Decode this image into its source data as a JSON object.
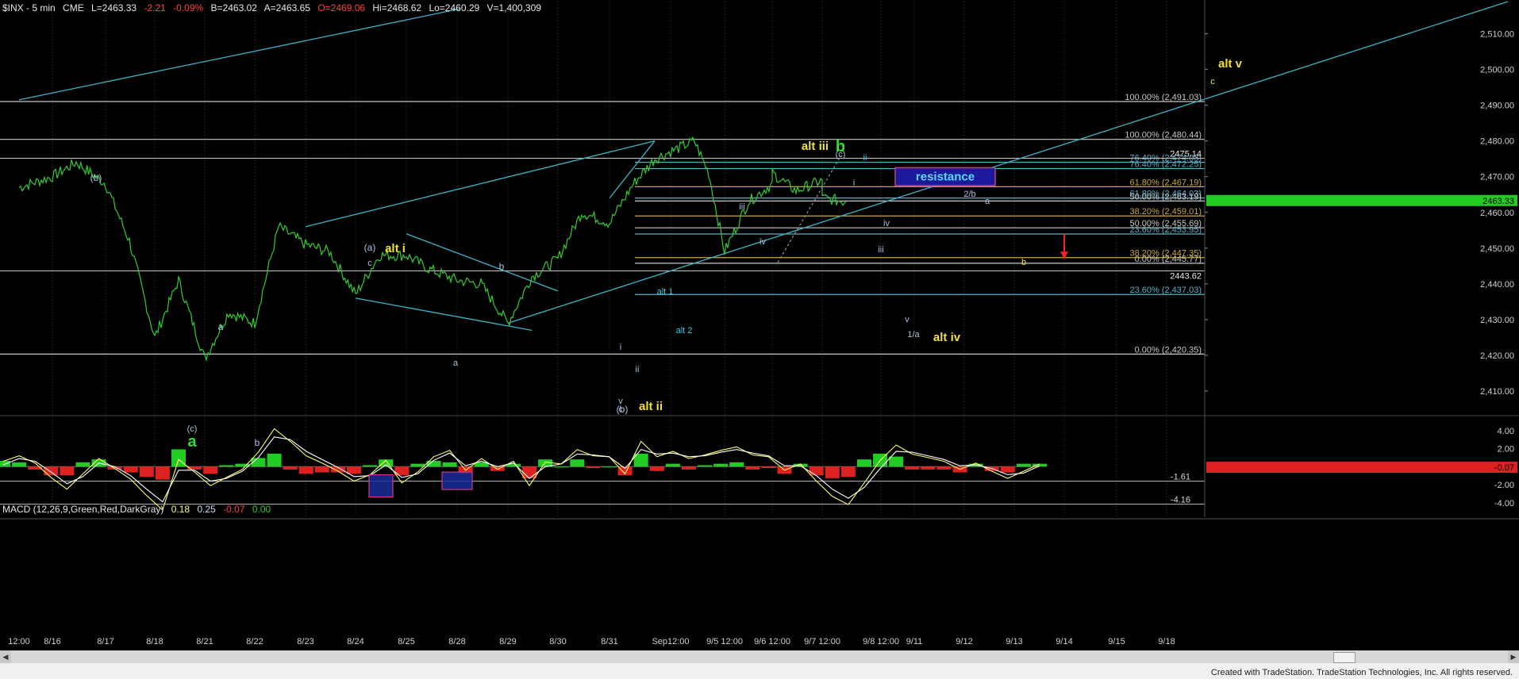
{
  "header": {
    "symbol": "$INX - 5 min",
    "exchange": "CME",
    "last": "L=2463.33",
    "change": "-2.21",
    "change_pct": "-0.09%",
    "bid": "B=2463.02",
    "ask": "A=2463.65",
    "open": "O=2469.06",
    "high": "Hi=2468.62",
    "low": "Lo=2460.29",
    "volume": "V=1,400,309"
  },
  "macd_header": {
    "name": "MACD (12,26,9,Green,Red,DarkGray)",
    "v1": "0.18",
    "v2": "0.25",
    "v3": "-0.07",
    "v4": "0.00"
  },
  "price_axis": {
    "ticks": [
      "2,510.00",
      "2,500.00",
      "2,490.00",
      "2,480.00",
      "2,470.00",
      "2,460.00",
      "2,450.00",
      "2,440.00",
      "2,430.00",
      "2,420.00",
      "2,410.00"
    ],
    "tick_values": [
      2510,
      2500,
      2490,
      2480,
      2470,
      2460,
      2450,
      2440,
      2430,
      2420,
      2410
    ],
    "ylim": [
      2404,
      2519
    ],
    "last_price_label": "2463.33"
  },
  "macd_axis": {
    "ticks": [
      "4.00",
      "2.00",
      "-2.00",
      "-4.00"
    ],
    "tick_values": [
      4,
      2,
      -2,
      -4
    ],
    "ylim": [
      -5.6,
      5.3
    ],
    "labels": [
      "-1.61",
      "-4.16"
    ],
    "label_values": [
      -1.61,
      -4.16
    ],
    "current": "-0.07"
  },
  "x_axis": {
    "ticks": [
      "12:00",
      "8/16",
      "8/17",
      "8/18",
      "8/21",
      "8/22",
      "8/23",
      "8/24",
      "8/25",
      "8/28",
      "8/29",
      "8/30",
      "8/31",
      "Sep12:00",
      "9/5 12:00",
      "9/6 12:00",
      "9/7 12:00",
      "9/8 12:00",
      "9/11",
      "9/12",
      "9/13",
      "9/14",
      "9/15",
      "9/18"
    ]
  },
  "fib_levels": [
    {
      "label": "100.00% (2,491.03)",
      "value": 2491.03,
      "color": "#c8c8c8"
    },
    {
      "label": "100.00% (2,480.44)",
      "value": 2480.44,
      "color": "#c8c8c8"
    },
    {
      "label": "76.40% (2,474.03)",
      "value": 2474.03,
      "color": "#5ab0c8"
    },
    {
      "label": "76.40% (2,472.25)",
      "value": 2472.25,
      "color": "#5ab0c8"
    },
    {
      "label": "61.80% (2,467.19)",
      "value": 2467.19,
      "color": "#c8a83c"
    },
    {
      "label": "61.80% (2,464.03)",
      "value": 2464.03,
      "color": "#5ab0c8"
    },
    {
      "label": "50.00% (2,463.19)",
      "value": 2463.19,
      "color": "#c8c8c8"
    },
    {
      "label": "38.20% (2,459.01)",
      "value": 2459.01,
      "color": "#c8a83c"
    },
    {
      "label": "50.00% (2,455.69)",
      "value": 2455.69,
      "color": "#c8c8c8"
    },
    {
      "label": "23.60% (2,453.95)",
      "value": 2453.95,
      "color": "#5ab0c8"
    },
    {
      "label": "38.20% (2,447.35)",
      "value": 2447.35,
      "color": "#c8a83c"
    },
    {
      "label": "0.00% (2,445.77)",
      "value": 2445.77,
      "color": "#c8c8c8"
    },
    {
      "label": "23.60% (2,437.03)",
      "value": 2437.03,
      "color": "#5ab0c8"
    },
    {
      "label": "0.00% (2,420.35)",
      "value": 2420.35,
      "color": "#c8c8c8"
    }
  ],
  "price_labels": [
    {
      "label": "2475.14",
      "value": 2475.14
    },
    {
      "label": "2443.62",
      "value": 2443.62
    }
  ],
  "annotations": {
    "resistance": "resistance",
    "wave_labels": [
      {
        "text": "(b)",
        "color": "#a8c0e0"
      },
      {
        "text": "a",
        "color": "#33dd33"
      },
      {
        "text": "(c)",
        "color": "#a8c0e0"
      },
      {
        "text": "a",
        "color": "#a8c0e0"
      },
      {
        "text": "b",
        "color": "#a8c0e0"
      },
      {
        "text": "(a)",
        "color": "#a8c0e0"
      },
      {
        "text": "c",
        "color": "#a8c0e0"
      },
      {
        "text": "alt i",
        "color": "#f0e03c"
      },
      {
        "text": "b",
        "color": "#a8c0e0"
      },
      {
        "text": "a",
        "color": "#a8c0e0"
      },
      {
        "text": "alt 1",
        "color": "#40c8e0"
      },
      {
        "text": "alt 2",
        "color": "#40c8e0"
      },
      {
        "text": "i",
        "color": "#a8c0e0"
      },
      {
        "text": "ii",
        "color": "#a8c0e0"
      },
      {
        "text": "v",
        "color": "#a8c0e0"
      },
      {
        "text": "c",
        "color": "#a8c0e0"
      },
      {
        "text": "(b)",
        "color": "#a8c0e0"
      },
      {
        "text": "alt ii",
        "color": "#f0e03c"
      },
      {
        "text": "iii",
        "color": "#a8c0e0"
      },
      {
        "text": "iv",
        "color": "#a8c0e0"
      },
      {
        "text": "alt iii",
        "color": "#f0e03c"
      },
      {
        "text": "b",
        "color": "#33dd33"
      },
      {
        "text": "(c)",
        "color": "#a8c0e0"
      },
      {
        "text": "ii",
        "color": "#40c8e0"
      },
      {
        "text": "i",
        "color": "#a8c0e0"
      },
      {
        "text": "iv",
        "color": "#a8c0e0"
      },
      {
        "text": "iii",
        "color": "#a8c0e0"
      },
      {
        "text": "v",
        "color": "#a8c0e0"
      },
      {
        "text": "1/a",
        "color": "#a8c0e0"
      },
      {
        "text": "alt iv",
        "color": "#f0e03c"
      },
      {
        "text": "2/b",
        "color": "#a8c0e0"
      },
      {
        "text": "a",
        "color": "#a8c0e0"
      },
      {
        "text": "b",
        "color": "#f0e03c"
      },
      {
        "text": "alt v",
        "color": "#f0e03c"
      },
      {
        "text": "c",
        "color": "#f0e03c"
      }
    ]
  },
  "chart_data": [
    {
      "type": "line",
      "title": "$INX - 5 min",
      "series": [
        {
          "name": "",
          "color": "#33cc33",
          "x": [
            "8/15 12:00",
            "8/16",
            "8/16 pm",
            "8/17",
            "8/17 pm",
            "8/18",
            "8/18 pm",
            "8/21",
            "8/21 pm",
            "8/22",
            "8/22 pm",
            "8/23",
            "8/23 pm",
            "8/24",
            "8/24 pm",
            "8/25",
            "8/25 pm",
            "8/28",
            "8/28 pm",
            "8/29",
            "8/29 pm",
            "8/30",
            "8/30 pm",
            "8/31",
            "8/31 pm",
            "9/1",
            "9/1 pm",
            "9/5",
            "9/5 12:00",
            "9/5 pm",
            "9/6",
            "9/6 12:00",
            "9/6 pm",
            "9/7",
            "9/7 12:00",
            "9/7 pm"
          ],
          "values": [
            2467,
            2470,
            2474,
            2468,
            2452,
            2425,
            2441,
            2419,
            2432,
            2429,
            2456,
            2451,
            2449,
            2437,
            2448,
            2448,
            2444,
            2441,
            2440,
            2429,
            2442,
            2447,
            2460,
            2457,
            2468,
            2475,
            2480,
            2471,
            2449,
            2463,
            2468,
            2471,
            2466,
            2469,
            2464,
            2463
          ]
        }
      ],
      "ylim": [
        2404,
        2519
      ],
      "grid": false,
      "trendlines": [
        {
          "from": [
            "8/15 12:00",
            2491.5
          ],
          "to": [
            "8/22 pm",
            2517
          ]
        },
        {
          "from": [
            "8/23",
            2456
          ],
          "to": [
            "9/1",
            2480
          ]
        },
        {
          "from": [
            "8/29",
            2429
          ],
          "to": [
            "9/18",
            2519
          ]
        },
        {
          "from": [
            "8/31",
            2464
          ],
          "to": [
            "9/1",
            2480
          ]
        },
        {
          "from": [
            "8/24",
            2436
          ],
          "to": [
            "8/29 pm",
            2427
          ]
        },
        {
          "from": [
            "8/25",
            2454
          ],
          "to": [
            "8/30",
            2438
          ]
        }
      ]
    },
    {
      "type": "bar",
      "title": "MACD (12,26,9,Green,Red,DarkGray)",
      "ylim": [
        -5.6,
        5.3
      ],
      "series": [
        {
          "name": "",
          "color": "#ffff66",
          "values": [
            0.6,
            1.2,
            0.4,
            -1.2,
            -2.5,
            -0.8,
            0.9,
            -0.2,
            -1.4,
            -3.2,
            -4.8,
            0.8,
            -0.6,
            -2.1,
            -1.2,
            -0.3,
            1.6,
            4.2,
            2.8,
            1.2,
            0.4,
            -0.5,
            -1.6,
            -0.9,
            0.7,
            -1.8,
            -0.6,
            1.1,
            1.8,
            -0.4,
            0.9,
            -0.3,
            0.6,
            -2.1,
            0.5,
            0.3,
            1.9,
            1.2,
            1.1,
            -0.8,
            2.8,
            1.1,
            1.7,
            0.9,
            1.3,
            1.8,
            2.2,
            1.3,
            1.1,
            -0.4,
            0.3,
            -1.6,
            -3.3,
            -4.2,
            -1.8,
            0.7,
            2.4,
            1.4,
            1.0,
            0.6,
            -0.3,
            0.4,
            -0.5,
            -1.3,
            -0.5,
            0.3
          ]
        },
        {
          "name": "",
          "color": "#ffffff",
          "values": [
            0.2,
            0.9,
            0.6,
            -0.6,
            -1.9,
            -1.1,
            0.4,
            0.0,
            -1.0,
            -2.5,
            -3.9,
            -0.4,
            -0.4,
            -1.6,
            -1.3,
            -0.5,
            1.0,
            3.3,
            3.0,
            1.7,
            0.8,
            -0.1,
            -1.1,
            -1.0,
            0.2,
            -1.2,
            -0.8,
            0.7,
            1.5,
            0.1,
            0.6,
            0.0,
            0.4,
            -1.3,
            0.0,
            0.3,
            1.4,
            1.3,
            1.1,
            -0.2,
            1.9,
            1.4,
            1.5,
            1.1,
            1.2,
            1.6,
            1.9,
            1.5,
            1.2,
            0.1,
            0.1,
            -1.0,
            -2.5,
            -3.5,
            -2.3,
            -0.2,
            1.7,
            1.6,
            1.2,
            0.8,
            0.1,
            0.2,
            -0.2,
            -0.9,
            -0.7,
            0.1
          ]
        },
        {
          "name": "",
          "color": "#33cc33",
          "values": [
            0.4,
            0.3,
            -0.2,
            -0.6,
            -0.6,
            0.3,
            0.5,
            -0.2,
            -0.4,
            -0.7,
            -0.9,
            1.2,
            -0.2,
            -0.5,
            0.1,
            0.2,
            0.6,
            0.9,
            -0.2,
            -0.5,
            -0.4,
            -0.4,
            -0.5,
            0.1,
            0.5,
            -0.6,
            0.2,
            0.4,
            0.3,
            -0.5,
            0.3,
            -0.3,
            0.2,
            -0.8,
            0.5,
            0.0,
            0.5,
            -0.1,
            0.0,
            -0.6,
            0.9,
            -0.3,
            0.2,
            -0.2,
            0.1,
            0.2,
            0.3,
            -0.2,
            -0.1,
            -0.5,
            0.2,
            -0.6,
            -0.8,
            -0.7,
            0.5,
            0.9,
            0.7,
            -0.2,
            -0.2,
            -0.2,
            -0.4,
            0.2,
            -0.3,
            -0.4,
            0.2,
            0.2
          ]
        }
      ]
    }
  ]
}
